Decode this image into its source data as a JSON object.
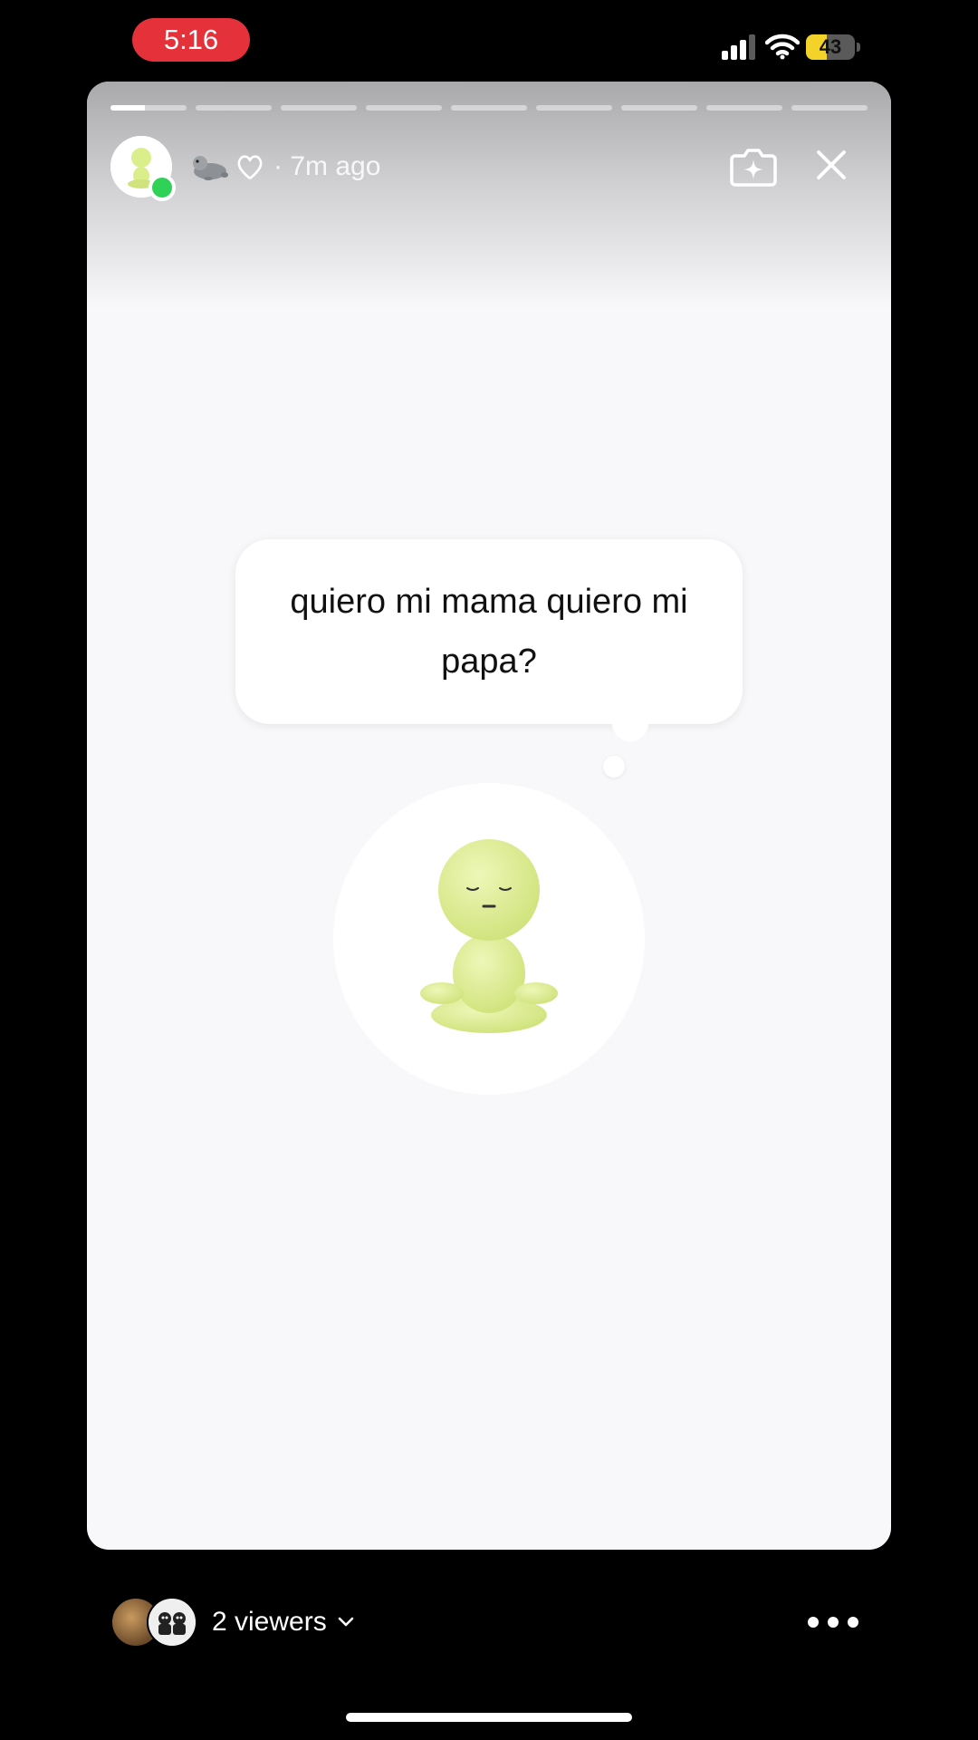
{
  "status_bar": {
    "time": "5:16",
    "battery_level": "43",
    "battery_fraction": 0.43,
    "icons": [
      "signal-icon",
      "wifi-icon",
      "battery-icon"
    ]
  },
  "story": {
    "progress": {
      "segments": 9,
      "active_index": 0,
      "active_fill": 0.45
    },
    "author": {
      "avatar_icon": "green-figure-avatar",
      "name_icons": [
        "seal-emoji",
        "heart-outline-icon"
      ],
      "online": true
    },
    "time_ago": "· 7m ago",
    "actions": {
      "camera_icon": "sparkle-camera-icon",
      "close_icon": "close-icon"
    },
    "note": {
      "text": "quiero mi mama quiero mi papa?"
    },
    "figure_icon": "meditating-green-figure"
  },
  "footer": {
    "viewers_label": "2 viewers",
    "viewers_icon": "chevron-down-icon",
    "more_icon": "more-icon"
  },
  "colors": {
    "background": "#000000",
    "card": "#f8f8fa",
    "recording_pill": "#e5323a",
    "battery": "#f3d22a",
    "online_dot": "#2fd157",
    "figure": "#dbee8c"
  }
}
